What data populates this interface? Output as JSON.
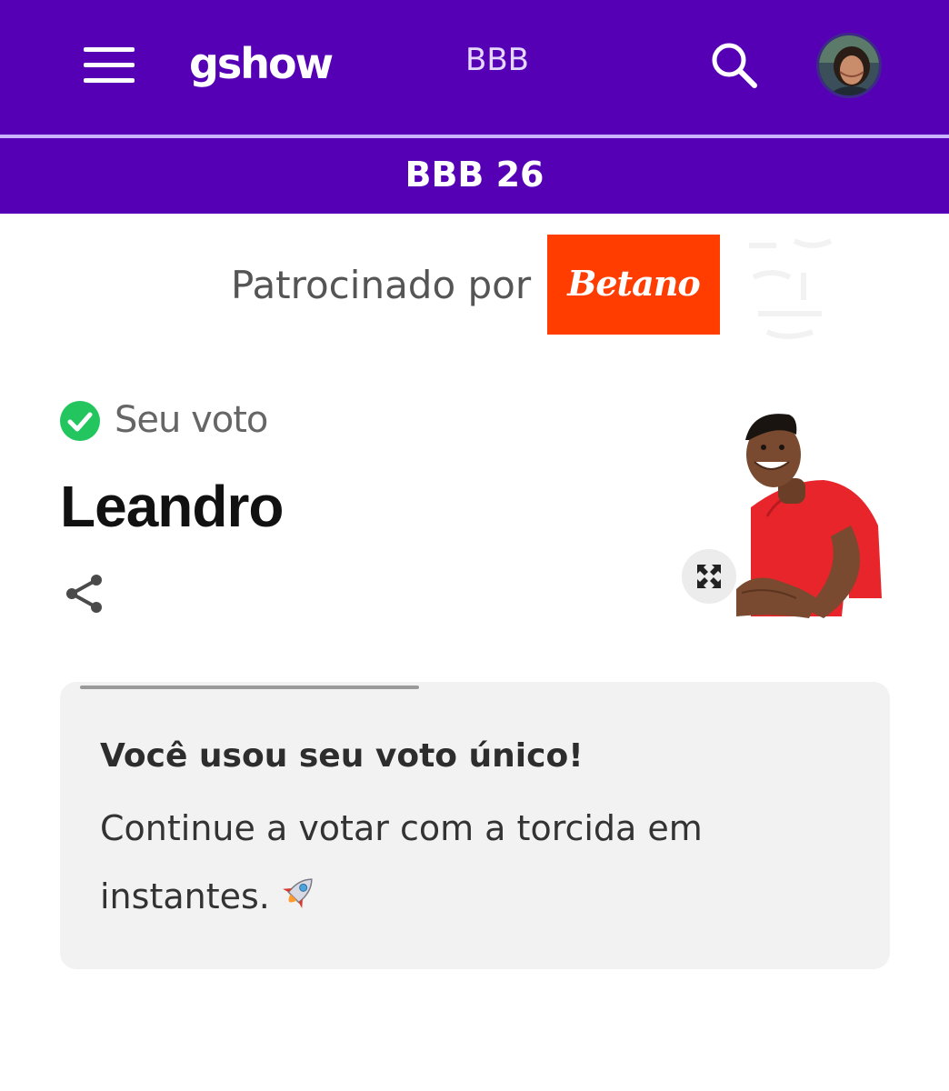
{
  "header": {
    "menu_icon": "hamburger-menu-icon",
    "logo": "gshow",
    "nav_label": "BBB",
    "search_icon": "search-icon",
    "avatar_icon": "user-avatar"
  },
  "subheader": {
    "title": "BBB 26"
  },
  "sponsor": {
    "label": "Patrocinado por",
    "brand": "Betano",
    "brand_color": "#ff3d00"
  },
  "vote": {
    "status_icon": "check-circle-icon",
    "status_label": "Seu voto",
    "candidate_name": "Leandro",
    "share_icon": "share-icon",
    "expand_icon": "expand-icon"
  },
  "notice": {
    "title": "Você usou seu voto único!",
    "body": "Continue a votar com a torcida em instantes.",
    "emoji_icon": "rocket-icon"
  },
  "colors": {
    "brand_purple": "#5500b5",
    "divider": "#c9b4ff",
    "check_green": "#22c55e",
    "card_bg": "#f2f2f2"
  }
}
